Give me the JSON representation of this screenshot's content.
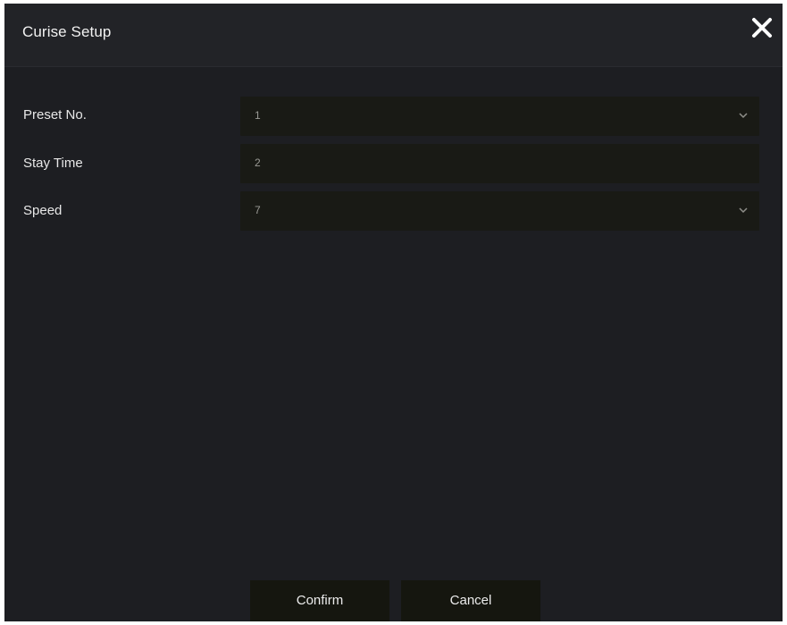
{
  "dialog": {
    "title": "Curise Setup",
    "close_icon": "close-icon"
  },
  "form": {
    "preset": {
      "label": "Preset No.",
      "value": "1",
      "icon": "chevron-down-icon"
    },
    "stay_time": {
      "label": "Stay Time",
      "value": "2"
    },
    "speed": {
      "label": "Speed",
      "value": "7",
      "icon": "chevron-down-icon"
    }
  },
  "buttons": {
    "confirm": "Confirm",
    "cancel": "Cancel"
  },
  "colors": {
    "background": "#1d1e22",
    "field": "#191a15",
    "button": "#15160f",
    "text": "#e8e8e8"
  }
}
